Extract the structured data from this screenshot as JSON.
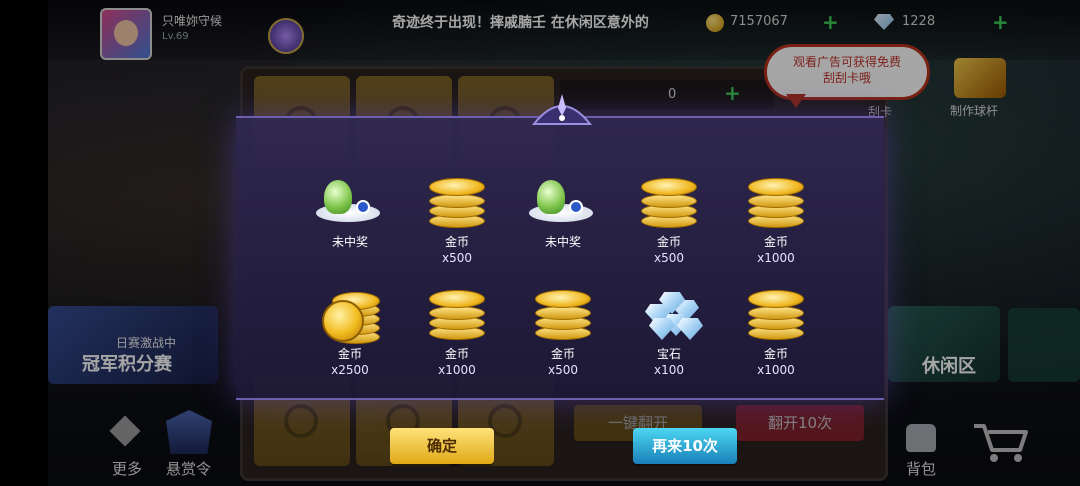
{
  "player": {
    "name": "只唯妳守候",
    "level": "Lv.69"
  },
  "marquee": "奇迹终于出现！摔戚腩壬 在休闲区意外的",
  "currency": {
    "coins": "7157067",
    "gems": "1228"
  },
  "ad_bubble": {
    "line1": "观看广告可获得免费",
    "line2": "刮刮卡哦"
  },
  "craft": {
    "label": "制作球杆"
  },
  "side_label": "刮卡",
  "counter": {
    "value": "0"
  },
  "left_banner": {
    "subtitle": "日赛激战中",
    "title": "冠军积分赛"
  },
  "right_banner": {
    "title": "休闲区"
  },
  "nav": {
    "more": "更多",
    "bounty": "悬赏令",
    "bag": "背包"
  },
  "back_buttons": {
    "open_all": "一键翻开",
    "open_ten": "翻开10次"
  },
  "prizes": [
    {
      "name": "未中奖",
      "amount": "",
      "icon": "cabbage-icon"
    },
    {
      "name": "金币",
      "amount": "x500",
      "icon": "coin-stack-icon"
    },
    {
      "name": "未中奖",
      "amount": "",
      "icon": "cabbage-icon"
    },
    {
      "name": "金币",
      "amount": "x500",
      "icon": "coin-stack-icon"
    },
    {
      "name": "金币",
      "amount": "x1000",
      "icon": "coin-stack-icon"
    },
    {
      "name": "金币",
      "amount": "x2500",
      "icon": "coin-pile-icon"
    },
    {
      "name": "金币",
      "amount": "x1000",
      "icon": "coin-stack-icon"
    },
    {
      "name": "金币",
      "amount": "x500",
      "icon": "coin-stack-icon"
    },
    {
      "name": "宝石",
      "amount": "x100",
      "icon": "diamond-icon"
    },
    {
      "name": "金币",
      "amount": "x1000",
      "icon": "coin-stack-icon"
    }
  ],
  "buttons": {
    "confirm": "确定",
    "again": "再来10次"
  },
  "colors": {
    "modal": "#2d2652",
    "confirm": "#f0c23a",
    "again": "#2aa6d8",
    "coin": "#f2bb1f"
  }
}
